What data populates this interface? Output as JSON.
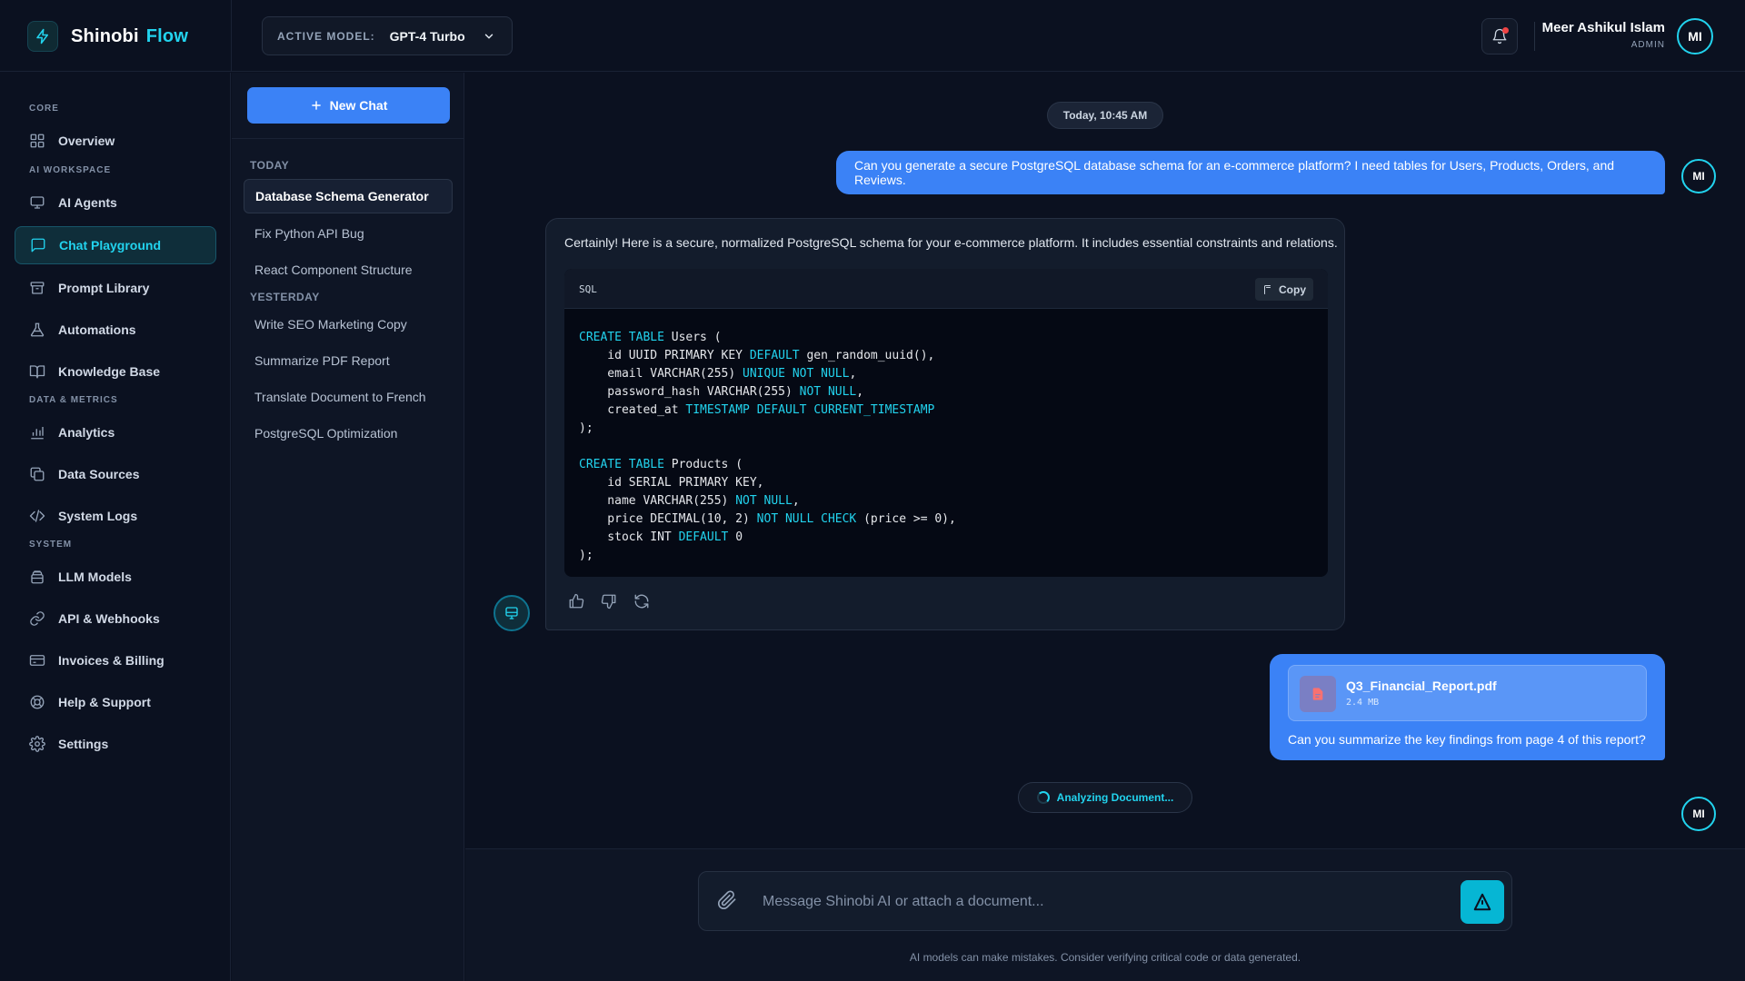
{
  "brand": {
    "name": "Shinobi",
    "accent": "Flow",
    "accent_color": "#22d3ee"
  },
  "header": {
    "model_label": "ACTIVE MODEL:",
    "model_value": "GPT-4 Turbo",
    "user_name": "Meer Ashikul Islam",
    "user_role": "ADMIN",
    "user_initials": "MI"
  },
  "sidebar": {
    "sections": [
      "CORE",
      "AI WORKSPACE",
      "DATA & METRICS",
      "SYSTEM"
    ],
    "items": [
      {
        "label": "Overview",
        "icon": "grid-icon"
      },
      {
        "label": "AI Agents",
        "icon": "monitor-icon"
      },
      {
        "label": "Chat Playground",
        "icon": "chat-icon",
        "active": true
      },
      {
        "label": "Prompt Library",
        "icon": "archive-icon"
      },
      {
        "label": "Automations",
        "icon": "flask-icon"
      },
      {
        "label": "Knowledge Base",
        "icon": "book-icon"
      },
      {
        "label": "Analytics",
        "icon": "bar-chart-icon"
      },
      {
        "label": "Data Sources",
        "icon": "copy-icon"
      },
      {
        "label": "System Logs",
        "icon": "code-icon"
      },
      {
        "label": "LLM Models",
        "icon": "layers-icon"
      },
      {
        "label": "API & Webhooks",
        "icon": "link-icon"
      },
      {
        "label": "Invoices & Billing",
        "icon": "credit-card-icon"
      },
      {
        "label": "Help & Support",
        "icon": "lifebuoy-icon"
      },
      {
        "label": "Settings",
        "icon": "gear-icon"
      }
    ]
  },
  "history": {
    "new_chat": "New Chat",
    "groups": [
      {
        "label": "TODAY",
        "items": [
          "Database Schema Generator",
          "Fix Python API Bug",
          "React Component Structure"
        ]
      },
      {
        "label": "YESTERDAY",
        "items": [
          "Write SEO Marketing Copy",
          "Summarize PDF Report",
          "Translate Document to French",
          "PostgreSQL Optimization"
        ]
      }
    ]
  },
  "chat": {
    "date": "Today, 10:45 AM",
    "user_message_1": "Can you generate a secure PostgreSQL database schema for an e-commerce platform? I need tables for Users, Products, Orders, and Reviews.",
    "ai_intro": "Certainly! Here is a secure, normalized PostgreSQL schema for your e-commerce platform. It includes essential constraints and relations.",
    "code_lang": "SQL",
    "copy_label": "Copy",
    "code_lines": [
      "CREATE TABLE Users (",
      "    id UUID PRIMARY KEY DEFAULT gen_random_uuid(),",
      "    email VARCHAR(255) UNIQUE NOT NULL,",
      "    password_hash VARCHAR(255) NOT NULL,",
      "    created_at TIMESTAMP DEFAULT CURRENT_TIMESTAMP",
      ");",
      "",
      "CREATE TABLE Products (",
      "    id SERIAL PRIMARY KEY,",
      "    name VARCHAR(255) NOT NULL,",
      "    price DECIMAL(10, 2) NOT NULL CHECK (price >= 0),",
      "    stock INT DEFAULT 0",
      ");"
    ],
    "file_name": "Q3_Financial_Report.pdf",
    "file_size": "2.4 MB",
    "user_message_2": "Can you summarize the key findings from page 4 of this report?",
    "status": "Analyzing Document..."
  },
  "composer": {
    "placeholder": "Message Shinobi AI or attach a document...",
    "disclaimer": "AI models can make mistakes. Consider verifying critical code or data generated."
  }
}
